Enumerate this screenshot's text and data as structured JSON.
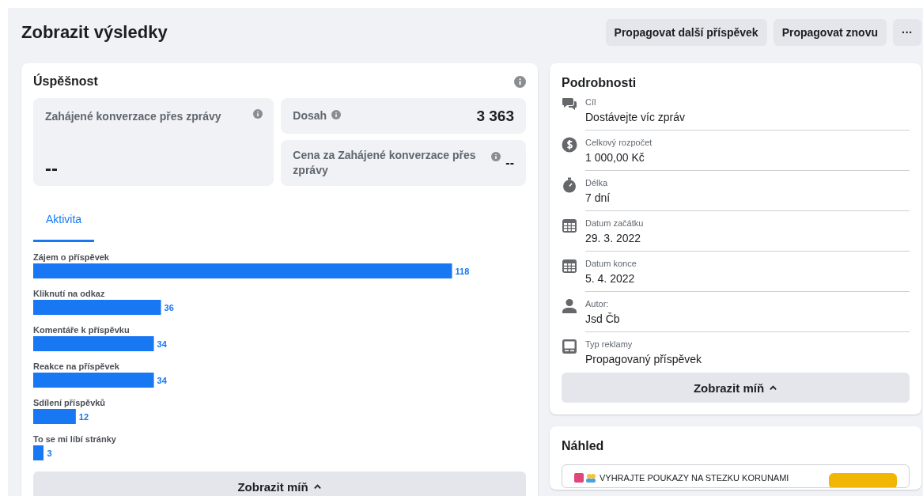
{
  "page": {
    "title": "Zobrazit výsledky",
    "actions": [
      "Propagovat další příspěvek",
      "Propagovat znovu",
      "···"
    ]
  },
  "performance": {
    "title": "Úspěšnost",
    "metrics": [
      {
        "label": "Zahájené konverzace přes zprávy",
        "value": "--"
      },
      {
        "label": "Dosah",
        "value": "3 363"
      },
      {
        "label": "Cena za Zahájené konverzace přes zprávy",
        "value": "--"
      }
    ],
    "tabs": [
      {
        "label": "Aktivita",
        "selected": true
      }
    ],
    "chart_data": {
      "type": "bar",
      "orientation": "horizontal",
      "data_labels": true,
      "categories": [
        "Zájem o příspěvek",
        "Kliknutí na odkaz",
        "Komentáře k příspěvku",
        "Reakce na příspěvek",
        "Sdílení příspěvků",
        "To se mi líbí stránky"
      ],
      "values": [
        118,
        36,
        34,
        34,
        12,
        3
      ]
    },
    "show_less": "Zobrazit míň"
  },
  "details": {
    "title": "Podrobnosti",
    "items": [
      {
        "kind": "chat",
        "label": "Cíl",
        "value": "Dostávejte víc zpráv"
      },
      {
        "kind": "money",
        "label": "Celkový rozpočet",
        "value": "1 000,00 Kč"
      },
      {
        "kind": "timer",
        "label": "Délka",
        "value": "7 dní"
      },
      {
        "kind": "calendar",
        "label": "Datum začátku",
        "value": "29. 3. 2022"
      },
      {
        "kind": "calendar",
        "label": "Datum konce",
        "value": "5. 4. 2022"
      },
      {
        "kind": "person",
        "label": "Autor:",
        "value": "Jsd Čb"
      },
      {
        "kind": "ad",
        "label": "Typ reklamy",
        "value": "Propagovaný příspěvek"
      }
    ],
    "show_less": "Zobrazit míň"
  },
  "preview": {
    "title": "Náhled",
    "headline": "VYHRAJTE POUKAZY NA STEZKU KORUNAMI"
  }
}
